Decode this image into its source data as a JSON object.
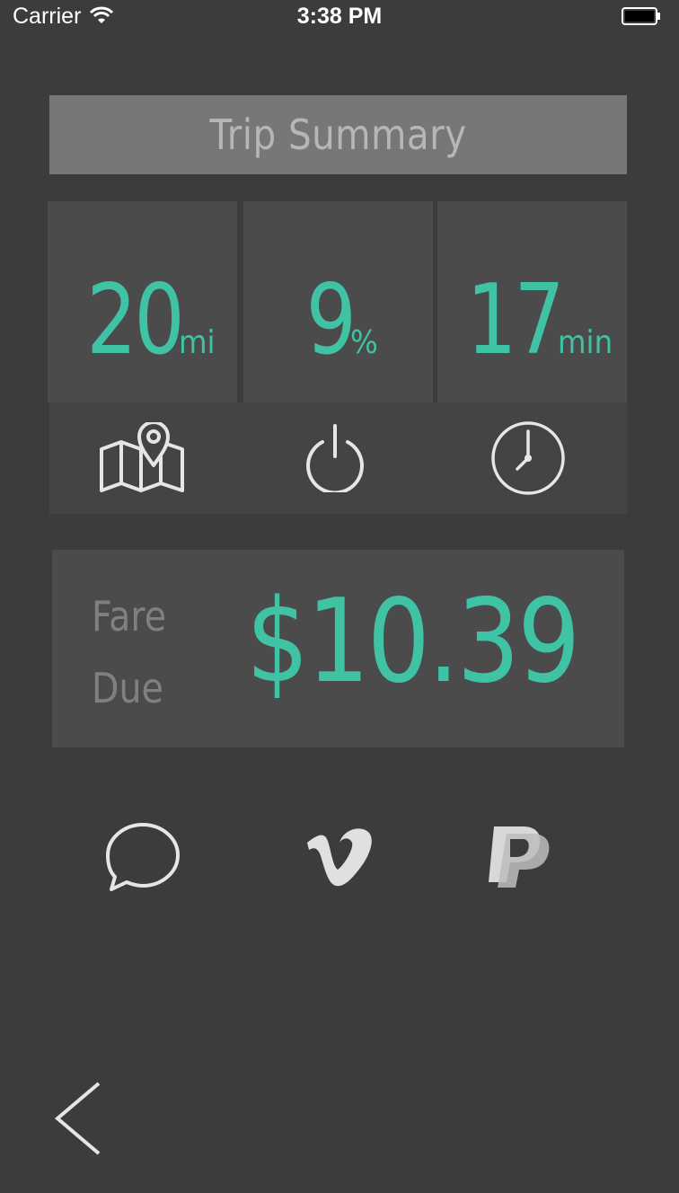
{
  "status_bar": {
    "carrier": "Carrier",
    "time": "3:38 PM"
  },
  "header": {
    "title": "Trip Summary"
  },
  "stats": [
    {
      "value": "20",
      "unit": "mi",
      "icon": "map-pin-icon"
    },
    {
      "value": "9",
      "unit": "%",
      "icon": "power-icon"
    },
    {
      "value": "17",
      "unit": "min",
      "icon": "clock-icon"
    }
  ],
  "fare": {
    "label_line1": "Fare",
    "label_line2": "Due",
    "amount": "$10.39"
  },
  "payment_options": [
    {
      "icon": "chat-bubble-icon"
    },
    {
      "icon": "vimeo-icon"
    },
    {
      "icon": "paypal-icon"
    }
  ],
  "colors": {
    "background": "#3c3c3c",
    "accent": "#40c2a4",
    "panel": "#4b4b4b",
    "title_bar": "#777777"
  }
}
